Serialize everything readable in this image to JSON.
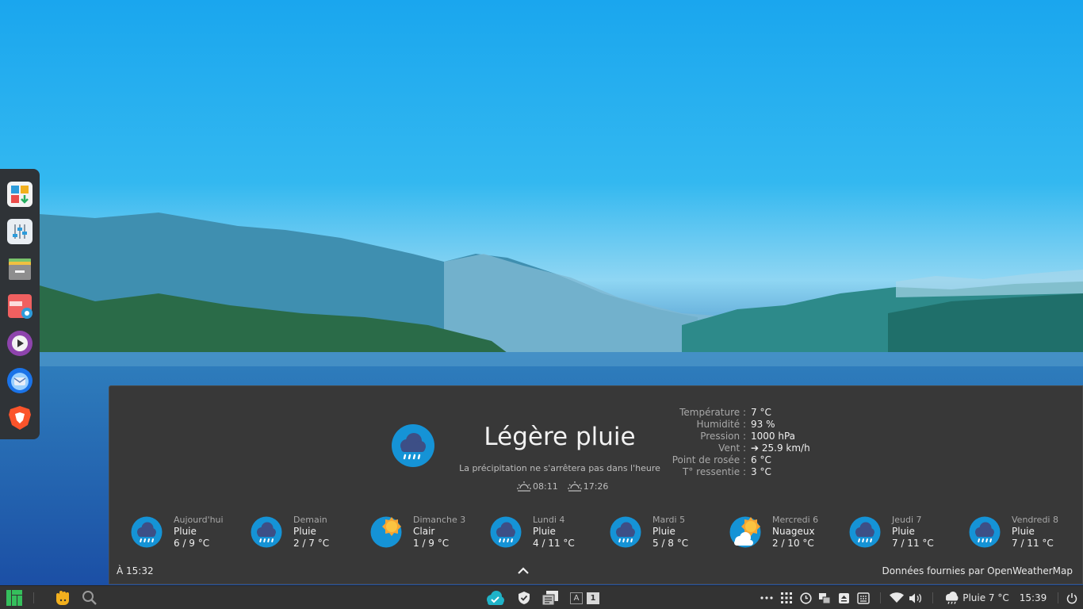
{
  "dock": {
    "apps": [
      {
        "name": "software-store-icon"
      },
      {
        "name": "settings-manager-icon"
      },
      {
        "name": "file-manager-icon"
      },
      {
        "name": "screenshot-tool-icon"
      },
      {
        "name": "media-player-icon"
      },
      {
        "name": "thunderbird-icon"
      },
      {
        "name": "brave-browser-icon"
      }
    ]
  },
  "weather": {
    "condition": "Légère pluie",
    "summary": "La précipitation ne s'arrêtera pas dans l'heure",
    "sunrise": "08:11",
    "sunset": "17:26",
    "details": [
      {
        "label": "Température :",
        "value": "7 °C"
      },
      {
        "label": "Humidité :",
        "value": "93 %"
      },
      {
        "label": "Pression :",
        "value": "1000 hPa"
      },
      {
        "label": "Vent :",
        "value": "➔ 25.9 km/h"
      },
      {
        "label": "Point de rosée :",
        "value": "6 °C"
      },
      {
        "label": "T° ressentie :",
        "value": "3 °C"
      }
    ],
    "forecast": [
      {
        "day": "Aujourd'hui",
        "condition": "Pluie",
        "temps": "6 / 9 °C",
        "icon": "rain-icon"
      },
      {
        "day": "Demain",
        "condition": "Pluie",
        "temps": "2 / 7 °C",
        "icon": "rain-icon"
      },
      {
        "day": "Dimanche 3",
        "condition": "Clair",
        "temps": "1 / 9 °C",
        "icon": "sun-icon"
      },
      {
        "day": "Lundi 4",
        "condition": "Pluie",
        "temps": "4 / 11 °C",
        "icon": "rain-icon"
      },
      {
        "day": "Mardi 5",
        "condition": "Pluie",
        "temps": "5 / 8 °C",
        "icon": "rain-icon"
      },
      {
        "day": "Mercredi 6",
        "condition": "Nuageux",
        "temps": "2 / 10 °C",
        "icon": "partly-cloudy-icon"
      },
      {
        "day": "Jeudi 7",
        "condition": "Pluie",
        "temps": "7 / 11 °C",
        "icon": "rain-icon"
      },
      {
        "day": "Vendredi 8",
        "condition": "Pluie",
        "temps": "7 / 11 °C",
        "icon": "rain-icon"
      }
    ],
    "updated": "À 15:32",
    "credit": "Données fournies par OpenWeatherMap"
  },
  "taskbar": {
    "keyboard_layout": "A",
    "workspace": "1",
    "weather_status": "Pluie 7 °C",
    "clock": "15:39"
  },
  "colors": {
    "panel_bg": "#383838",
    "taskbar_bg": "#333333",
    "icon_circle": "#1593d6",
    "cloud": "#3d4f86",
    "drops": "#ffffff",
    "sun": "#f7a532"
  }
}
